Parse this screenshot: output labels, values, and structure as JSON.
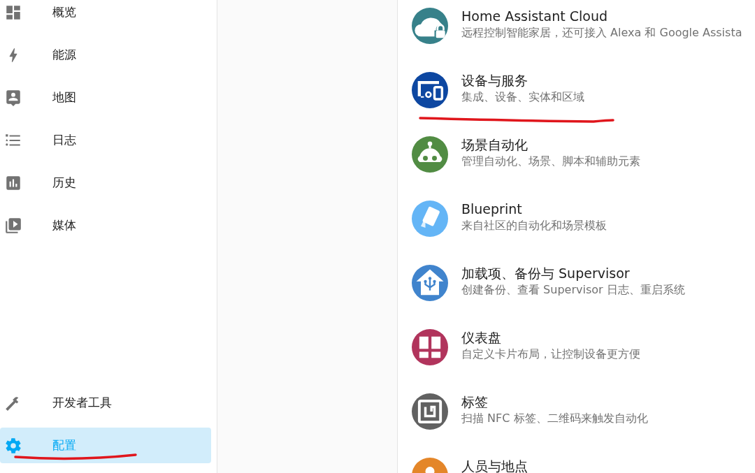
{
  "sidebar": {
    "items": [
      {
        "label": "概览",
        "kind": "dashboard",
        "selected": false,
        "underlined": false
      },
      {
        "label": "能源",
        "kind": "bolt",
        "selected": false,
        "underlined": false
      },
      {
        "label": "地图",
        "kind": "map",
        "selected": false,
        "underlined": false
      },
      {
        "label": "日志",
        "kind": "list",
        "selected": false,
        "underlined": false
      },
      {
        "label": "历史",
        "kind": "chart",
        "selected": false,
        "underlined": false
      },
      {
        "label": "媒体",
        "kind": "media",
        "selected": false,
        "underlined": false
      }
    ],
    "bottom_items": [
      {
        "label": "开发者工具",
        "kind": "hammer",
        "selected": false,
        "underlined": false
      },
      {
        "label": "配置",
        "kind": "gear",
        "selected": true,
        "underlined": true
      }
    ]
  },
  "settings": [
    {
      "title": "Home Assistant Cloud",
      "subtitle": "远程控制智能家居，还可接入 Alexa 和 Google Assista",
      "kind": "cloud",
      "color": "#37818a",
      "underlined": false
    },
    {
      "title": "设备与服务",
      "subtitle": "集成、设备、实体和区域",
      "kind": "devices",
      "color": "#0d47a1",
      "underlined": true
    },
    {
      "title": "场景自动化",
      "subtitle": "管理自动化、场景、脚本和辅助元素",
      "kind": "robot",
      "color": "#518c43",
      "underlined": false
    },
    {
      "title": "Blueprint",
      "subtitle": "来自社区的自动化和场景模板",
      "kind": "blueprint",
      "color": "#64b5f6",
      "underlined": false
    },
    {
      "title": "加载项、备份与 Supervisor",
      "subtitle": "创建备份、查看 Supervisor 日志、重启系统",
      "kind": "home",
      "color": "#4084cd",
      "underlined": false
    },
    {
      "title": "仪表盘",
      "subtitle": "自定义卡片布局，让控制设备更方便",
      "kind": "grid",
      "color": "#b1345c",
      "underlined": false
    },
    {
      "title": "标签",
      "subtitle": "扫描 NFC 标签、二维码来触发自动化",
      "kind": "nfc",
      "color": "#616161",
      "underlined": false
    },
    {
      "title": "人员与地点",
      "kind": "person",
      "color": "#e48629",
      "underlined": false
    }
  ]
}
